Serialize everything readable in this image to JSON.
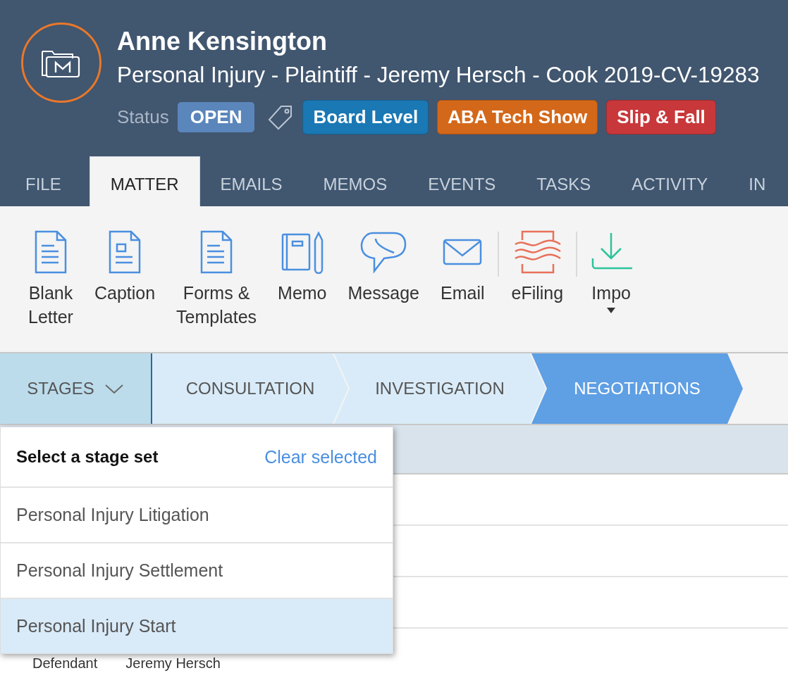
{
  "header": {
    "name": "Anne Kensington",
    "subtitle": "Personal Injury - Plaintiff - Jeremy Hersch - Cook 2019-CV-19283",
    "status_label": "Status",
    "status": "OPEN",
    "tags": [
      {
        "label": "Board Level",
        "color": "#1a78b4"
      },
      {
        "label": "ABA Tech Show",
        "color": "#d4681a"
      },
      {
        "label": "Slip & Fall",
        "color": "#c8373a"
      }
    ]
  },
  "tabs": [
    {
      "label": "FILE",
      "selected": false
    },
    {
      "label": "MATTER",
      "selected": true
    },
    {
      "label": "EMAILS",
      "selected": false
    },
    {
      "label": "MEMOS",
      "selected": false
    },
    {
      "label": "EVENTS",
      "selected": false
    },
    {
      "label": "TASKS",
      "selected": false
    },
    {
      "label": "ACTIVITY",
      "selected": false
    },
    {
      "label": "IN",
      "selected": false
    }
  ],
  "toolbar": [
    {
      "kind": "letter",
      "lines": [
        "Blank",
        "Letter"
      ]
    },
    {
      "kind": "caption",
      "lines": [
        "Caption"
      ]
    },
    {
      "kind": "forms",
      "lines": [
        "Forms &",
        "Templates"
      ]
    },
    {
      "kind": "memo",
      "lines": [
        "Memo"
      ]
    },
    {
      "kind": "message",
      "lines": [
        "Message"
      ]
    },
    {
      "kind": "email",
      "lines": [
        "Email"
      ]
    },
    {
      "kind": "efiling",
      "lines": [
        "eFiling"
      ]
    },
    {
      "kind": "import",
      "lines": [
        "Impo"
      ]
    }
  ],
  "stages": {
    "label": "STAGES",
    "items": [
      {
        "label": "CONSULTATION",
        "selected": false
      },
      {
        "label": "INVESTIGATION",
        "selected": false
      },
      {
        "label": "NEGOTIATIONS",
        "selected": true
      }
    ]
  },
  "stage_menu": {
    "title": "Select a stage set",
    "clear": "Clear selected",
    "items": [
      {
        "label": "Personal Injury Litigation",
        "selected": false
      },
      {
        "label": "Personal Injury Settlement",
        "selected": false
      },
      {
        "label": "Personal Injury Start",
        "selected": true
      }
    ]
  },
  "row": {
    "label": "Defendant",
    "value": "Jeremy Hersch"
  }
}
